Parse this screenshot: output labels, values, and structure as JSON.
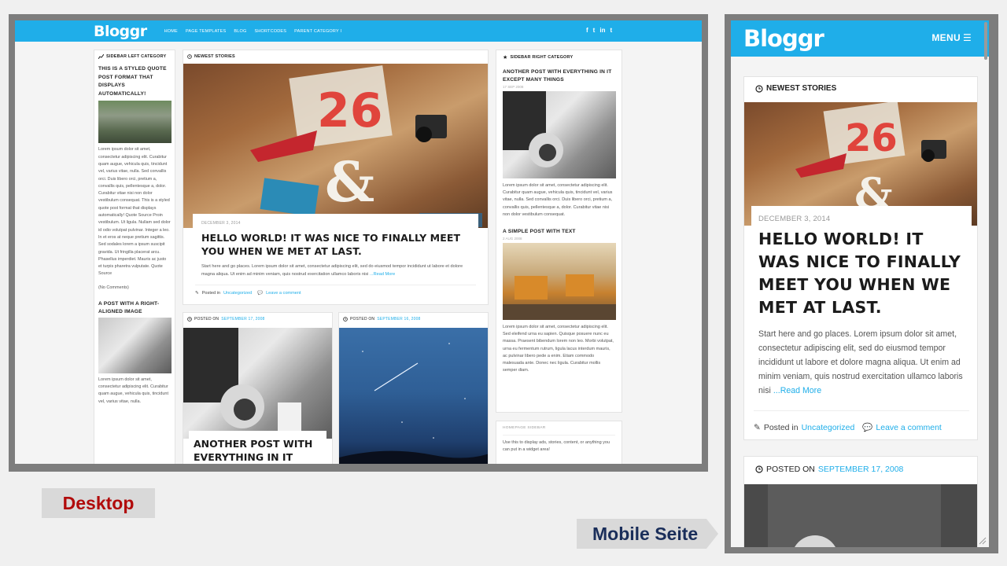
{
  "labels": {
    "desktop": "Desktop",
    "mobile": "Mobile Seite"
  },
  "desktop": {
    "logo": "Bloggr",
    "menu": [
      "HOME",
      "PAGE TEMPLATES",
      "BLOG",
      "SHORTCODES",
      "PARENT CATEGORY I"
    ],
    "social": [
      "f",
      "t",
      "in",
      "t"
    ],
    "left_sidebar": {
      "heading": "SIDEBAR LEFT CATEGORY",
      "post1_title": "THIS IS A STYLED QUOTE POST FORMAT THAT DISPLAYS AUTOMATICALLY!",
      "post1_text": "Lorem ipsum dolor sit amet, consectetur adipiscing elit. Curabitur quam augue, vehicula quis, tincidunt vel, varius vitae, nulla. Sed convallis orci. Duis libero orci, pretium a, convallis quis, pellentesque a, dolor. Curabitur vitae nisi non dolor vestibulum consequat. This is a styled quote post format that displays automatically! Quote Source Proin vestibulum. Ut ligula. Nullam sed dolor id odio volutpat pulvinar. Integer a leo. In et eros at neque pretium sagittis. Sed sodales lorem a ipsum suscipit gravida. Ut fringilla placerat arcu. Phasellus imperdiet. Mauris ac justo et turpis pharetra vulputate. Quote Source",
      "comments": "(No Comments)",
      "post2_title": "A POST WITH A RIGHT-ALIGNED IMAGE",
      "post2_text": "Lorem ipsum dolor sit amet, consectetur adipiscing elit. Curabitur quam augue, vehicula quis, tincidunt vel, varius vitae, nulla."
    },
    "featured": {
      "heading": "NEWEST STORIES",
      "date": "DECEMBER 3, 2014",
      "title": "HELLO WORLD! IT WAS NICE TO FINALLY MEET YOU WHEN WE MET AT LAST.",
      "excerpt": "Start here and go places. Lorem ipsum dolor sit amet, consectetur adipiscing elit, sed do eiusmod tempor incididunt ut labore et dolore magna aliqua. Ut enim ad minim veniam, quis nostrud exercitation ullamco laboris nisi",
      "read_more": "...Read More",
      "posted_in": "Posted in",
      "category": "Uncategorized",
      "comment": "Leave a comment"
    },
    "grid": [
      {
        "posted_on": "POSTED ON",
        "date": "SEPTEMBER 17, 2008",
        "title": "ANOTHER POST WITH EVERYTHING IN IT EXCEPT"
      },
      {
        "posted_on": "POSTED ON",
        "date": "SEPTEMBER 16, 2008"
      }
    ],
    "right_sidebar": {
      "heading": "SIDEBAR RIGHT CATEGORY",
      "post1_title": "ANOTHER POST WITH EVERYTHING IN IT EXCEPT MANY THINGS",
      "post1_date": "17 SEP 2008",
      "post1_text": "Lorem ipsum dolor sit amet, consectetur adipiscing elit. Curabitur quam augue, vehicula quis, tincidunt vel, varius vitae, nulla. Sed convallis orci. Duis libero orci, pretium a, convallis quis, pellentesque a, dolor. Curabitur vitae nisi non dolor vestibulum consequat.",
      "post2_title": "A SIMPLE POST WITH TEXT",
      "post2_date": "2 AUG 2008",
      "post2_text": "Lorem ipsum dolor sit amet, consectetur adipiscing elit. Sed eleifend urna eu sapien. Quisque posuere nunc eu massa. Praesent bibendum lorem non leo. Morbi volutpat, urna eu fermentum rutrum, ligula lacus interdum mauris, ac pulvinar libero pede a enim. Etiam commodo malesuada ante. Donec nec ligula. Curabitur mollis semper diam."
    },
    "homepage_sidebar": {
      "heading": "HOMEPAGE SIDEBAR",
      "text": "Use this to display ads, stories, content, or anything you can put in a widget area!"
    }
  },
  "mobile": {
    "logo": "Bloggr",
    "menu": "MENU",
    "heading": "NEWEST STORIES",
    "date": "DECEMBER 3, 2014",
    "title": "HELLO WORLD! IT WAS NICE TO FINALLY MEET YOU WHEN WE MET AT LAST.",
    "excerpt": "Start here and go places. Lorem ipsum dolor sit amet, consectetur adipiscing elit, sed do eiusmod tempor incididunt ut labore et dolore magna aliqua. Ut enim ad minim veniam, quis nostrud exercitation ullamco laboris nisi",
    "read_more": "...Read More",
    "posted_in": "Posted in",
    "category": "Uncategorized",
    "comment": "Leave a comment",
    "posted_on": "POSTED ON",
    "post2_date": "SEPTEMBER 17, 2008"
  },
  "colors": {
    "accent": "#1faee9",
    "frame": "#7d7d7d",
    "label_red": "#b10b0b",
    "label_navy": "#1a2e5a"
  },
  "icons": [
    "chart-icon",
    "clock-icon",
    "star-icon",
    "pencil-icon",
    "comment-icon",
    "hamburger-icon",
    "facebook-icon",
    "twitter-icon",
    "linkedin-icon",
    "tumblr-icon"
  ]
}
